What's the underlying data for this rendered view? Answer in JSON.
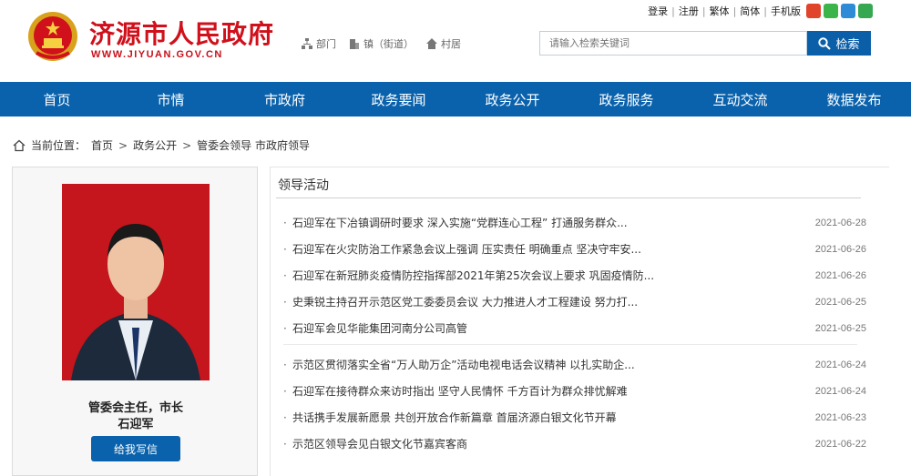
{
  "header": {
    "title": "济源市人民政府",
    "url": "WWW.JIYUAN.GOV.CN",
    "quick_links": [
      {
        "label": "部门",
        "icon": "org-icon"
      },
      {
        "label": "镇（街道）",
        "icon": "building-icon"
      },
      {
        "label": "村居",
        "icon": "home-icon"
      }
    ],
    "top_links": [
      "登录",
      "注册",
      "繁体",
      "简体",
      "手机版"
    ],
    "social_icons": [
      "weibo-icon",
      "wechat-icon",
      "app-icon",
      "accessibility-icon"
    ],
    "search": {
      "placeholder": "请输入检索关键词",
      "button_label": "检索"
    }
  },
  "nav": {
    "items": [
      "首页",
      "市情",
      "市政府",
      "政务要闻",
      "政务公开",
      "政务服务",
      "互动交流",
      "数据发布"
    ]
  },
  "breadcrumb": {
    "prefix": "当前位置：",
    "items": [
      "首页",
      "政务公开",
      "管委会领导 市政府领导"
    ]
  },
  "profile": {
    "title": "管委会主任，市长",
    "name": "石迎军",
    "button_label": "给我写信"
  },
  "news": {
    "section_title": "领导活动",
    "group1": [
      {
        "text": "石迎军在下冶镇调研时要求 深入实施“党群连心工程” 打通服务群众...",
        "date": "2021-06-28"
      },
      {
        "text": "石迎军在火灾防治工作紧急会议上强调 压实责任 明确重点 坚决守牢安...",
        "date": "2021-06-26"
      },
      {
        "text": "石迎军在新冠肺炎疫情防控指挥部2021年第25次会议上要求 巩固疫情防...",
        "date": "2021-06-26"
      },
      {
        "text": "史秉锐主持召开示范区党工委委员会议 大力推进人才工程建设 努力打...",
        "date": "2021-06-25"
      },
      {
        "text": "石迎军会见华能集团河南分公司高管",
        "date": "2021-06-25"
      }
    ],
    "group2": [
      {
        "text": "示范区贯彻落实全省“万人助万企”活动电视电话会议精神 以扎实助企...",
        "date": "2021-06-24"
      },
      {
        "text": "石迎军在接待群众来访时指出 坚守人民情怀 千方百计为群众排忧解难",
        "date": "2021-06-24"
      },
      {
        "text": "共话携手发展新愿景 共创开放合作新篇章 首届济源白银文化节开幕",
        "date": "2021-06-23"
      },
      {
        "text": "示范区领导会见白银文化节嘉宾客商",
        "date": "2021-06-22"
      }
    ]
  },
  "colors": {
    "brand_red": "#d0101b",
    "nav_blue": "#0a62ac"
  }
}
